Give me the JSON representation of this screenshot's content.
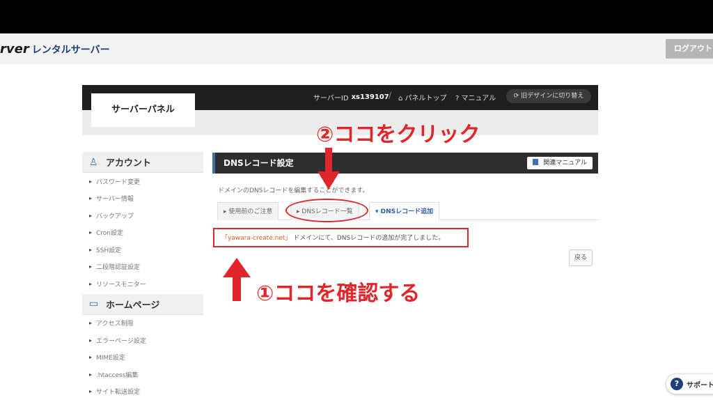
{
  "header": {
    "brand_mark": "rver",
    "brand_sub": "レンタルサーバー",
    "logout_label": "ログアウト"
  },
  "panel": {
    "title": "サーバーパネル",
    "server_id_label": "サーバーID",
    "server_id_value": "xs139107",
    "separator": "/",
    "panel_top_label": "パネルトップ",
    "manual_label": "マニュアル",
    "redesign_label": "旧デザインに切り替え"
  },
  "sidebar": {
    "account_heading": "アカウント",
    "account_items": [
      "パスワード変更",
      "サーバー情報",
      "バックアップ",
      "Cron設定",
      "SSH設定",
      "二段階認証設定",
      "リソースモニター"
    ],
    "homepage_heading": "ホームページ",
    "homepage_items": [
      "アクセス制限",
      "エラーページ設定",
      "MIME設定",
      ".htaccess編集",
      "サイト転送設定"
    ]
  },
  "main": {
    "title": "DNSレコード設定",
    "manual_button": "関連マニュアル",
    "description": "ドメインのDNSレコードを編集することができます。",
    "tabs": [
      "使用前のご注意",
      "DNSレコード一覧",
      "DNSレコード追加"
    ],
    "message_domain": "「yawara-create.net」",
    "message_text": "ドメインにて、DNSレコードの追加が完了しました。",
    "back_button": "戻る"
  },
  "annotations": {
    "click_here": "②ココをクリック",
    "confirm_here": "①ココを確認する",
    "color": "#e0262b"
  },
  "support": {
    "label": "サポート"
  }
}
